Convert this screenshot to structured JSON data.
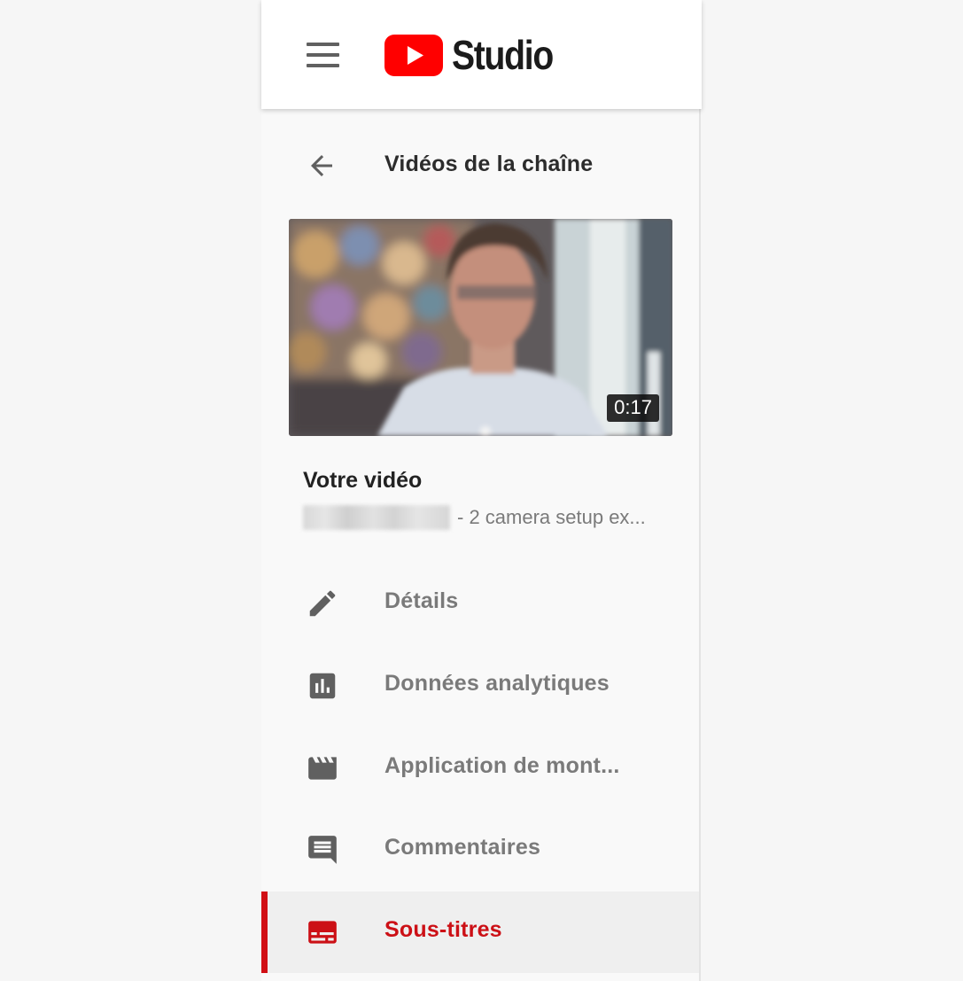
{
  "app": {
    "logo_text": "Studio",
    "brand_color": "#ff0000"
  },
  "back": {
    "title": "Vidéos de la chaîne"
  },
  "video": {
    "duration": "0:17",
    "title": "Votre vidéo",
    "subtitle": "- 2 camera setup ex..."
  },
  "nav": {
    "items": [
      {
        "label": "Détails",
        "icon": "pencil-icon"
      },
      {
        "label": "Données analytiques",
        "icon": "analytics-icon"
      },
      {
        "label": "Application de mont...",
        "icon": "clapperboard-icon"
      },
      {
        "label": "Commentaires",
        "icon": "comment-icon"
      },
      {
        "label": "Sous-titres",
        "icon": "subtitles-icon",
        "active": true
      }
    ]
  },
  "colors": {
    "active_accent": "#cc1016",
    "icon_gray": "#606060",
    "label_gray": "#7a7a7a"
  }
}
